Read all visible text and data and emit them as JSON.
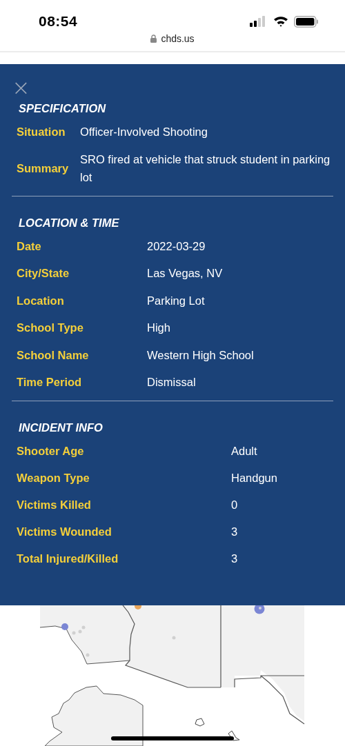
{
  "status_bar": {
    "time": "08:54",
    "url": "chds.us"
  },
  "panel": {
    "close": "×",
    "sections": [
      {
        "title": "SPECIFICATION",
        "rows": [
          {
            "label": "Situation",
            "value": "Officer-Involved Shooting"
          },
          {
            "label": "Summary",
            "value": "SRO fired at vehicle that struck student in parking lot"
          }
        ]
      },
      {
        "title": "LOCATION & TIME",
        "rows": [
          {
            "label": "Date",
            "value": "2022-03-29"
          },
          {
            "label": "City/State",
            "value": "Las Vegas, NV"
          },
          {
            "label": "Location",
            "value": "Parking Lot"
          },
          {
            "label": "School Type",
            "value": "High"
          },
          {
            "label": "School Name",
            "value": "Western High School"
          },
          {
            "label": "Time Period",
            "value": "Dismissal"
          }
        ]
      },
      {
        "title": "INCIDENT INFO",
        "rows": [
          {
            "label": "Shooter Age",
            "value": "Adult"
          },
          {
            "label": "Weapon Type",
            "value": "Handgun"
          },
          {
            "label": "Victims Killed",
            "value": "0"
          },
          {
            "label": "Victims Wounded",
            "value": "3"
          },
          {
            "label": "Total Injured/Killed",
            "value": "3"
          }
        ]
      }
    ]
  }
}
